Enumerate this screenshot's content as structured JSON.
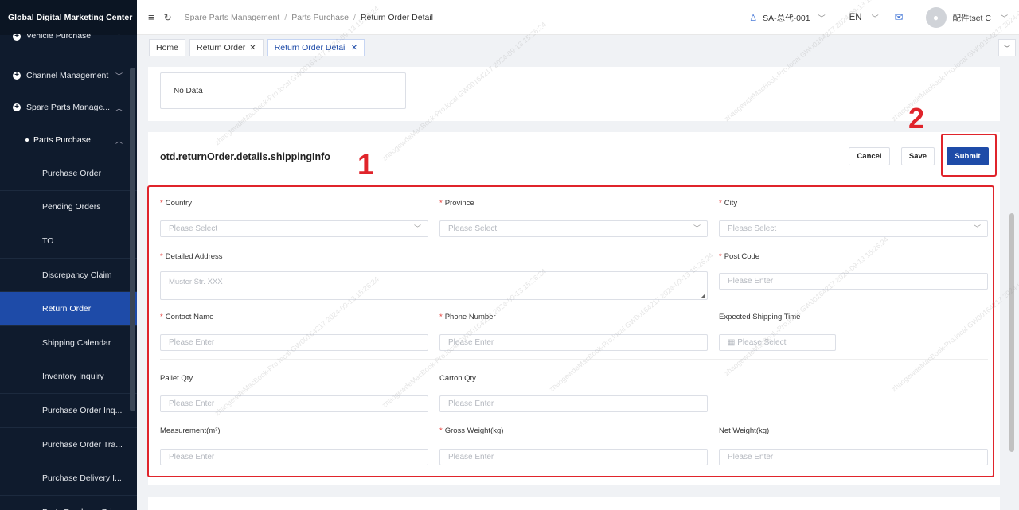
{
  "brand": "Global Digital Marketing Center",
  "sidebar": {
    "groups": [
      {
        "label": "Vehicle Purchase"
      },
      {
        "label": "Channel Management"
      },
      {
        "label": "Spare Parts Manage..."
      }
    ],
    "subgroup": "Parts Purchase",
    "items": [
      {
        "label": "Purchase Order"
      },
      {
        "label": "Pending Orders"
      },
      {
        "label": "TO"
      },
      {
        "label": "Discrepancy Claim"
      },
      {
        "label": "Return Order"
      },
      {
        "label": "Shipping Calendar"
      },
      {
        "label": "Inventory Inquiry"
      },
      {
        "label": "Purchase Order Inq..."
      },
      {
        "label": "Purchase Order Tra..."
      },
      {
        "label": "Purchase Delivery I..."
      },
      {
        "label": "Parts Purchase Price"
      }
    ]
  },
  "header": {
    "breadcrumb": [
      "Spare Parts Management",
      "Parts Purchase",
      "Return Order Detail"
    ],
    "role": "SA-总代-001",
    "lang": "EN",
    "username": "配件tset C"
  },
  "tabs": [
    {
      "label": "Home"
    },
    {
      "label": "Return Order",
      "close": "✕"
    },
    {
      "label": "Return Order Detail",
      "close": "✕"
    }
  ],
  "top_panel": {
    "no_data": "No Data"
  },
  "shipping": {
    "title": "otd.returnOrder.details.shippingInfo",
    "buttons": {
      "cancel": "Cancel",
      "save": "Save",
      "submit": "Submit"
    },
    "required_mark": "*",
    "fields": {
      "country": {
        "label": "Country",
        "placeholder": "Please Select"
      },
      "province": {
        "label": "Province",
        "placeholder": "Please Select"
      },
      "city": {
        "label": "City",
        "placeholder": "Please Select"
      },
      "address": {
        "label": "Detailed Address",
        "placeholder": "Muster Str. XXX"
      },
      "postcode": {
        "label": "Post Code",
        "placeholder": "Please Enter"
      },
      "contact": {
        "label": "Contact Name",
        "placeholder": "Please Enter"
      },
      "phone": {
        "label": "Phone Number",
        "placeholder": "Please Enter"
      },
      "ship_time": {
        "label": "Expected Shipping Time",
        "placeholder": "Please Select"
      },
      "pallet": {
        "label": "Pallet Qty",
        "placeholder": "Please Enter"
      },
      "carton": {
        "label": "Carton Qty",
        "placeholder": "Please Enter"
      },
      "measure": {
        "label": "Measurement(m³)",
        "placeholder": "Please Enter"
      },
      "gross": {
        "label": "Gross Weight(kg)",
        "placeholder": "Please Enter"
      },
      "net": {
        "label": "Net Weight(kg)",
        "placeholder": "Please Enter"
      }
    }
  },
  "annotations": [
    "1",
    "2"
  ],
  "watermark": "zhaogewdeMacBook-Pro.local GW00164217 2024-09-13 15:26:24",
  "colors": {
    "sidebar_bg": "#0f1b2d",
    "active": "#1e4ba8",
    "annotation": "#e0242b"
  }
}
